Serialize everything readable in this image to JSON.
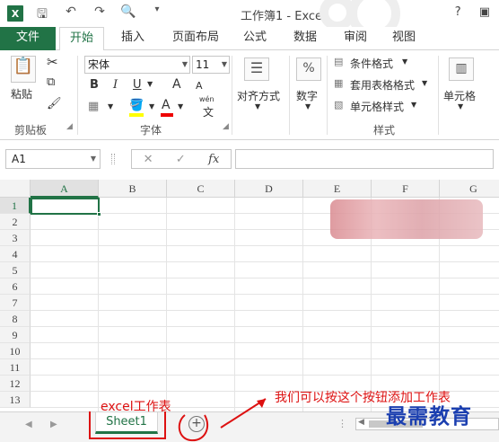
{
  "window": {
    "app_icon": "X",
    "title": "工作簿1 - Excel",
    "help": "?",
    "restore": "▣"
  },
  "ribbon_tabs": [
    "文件",
    "开始",
    "插入",
    "页面布局",
    "公式",
    "数据",
    "审阅",
    "视图"
  ],
  "clipboard": {
    "paste": "粘贴",
    "group": "剪贴板"
  },
  "font": {
    "name": "宋体",
    "size": "11",
    "bold": "B",
    "italic": "I",
    "underline": "U",
    "grow": "A",
    "shrink": "A",
    "font_color": "A",
    "phonetic_top": "wén",
    "phonetic_bottom": "文",
    "group": "字体"
  },
  "alignment": {
    "label": "对齐方式"
  },
  "number": {
    "label": "数字",
    "icon": "%"
  },
  "styles": {
    "conditional": "条件格式",
    "table": "套用表格格式",
    "cell_styles": "单元格样式",
    "group": "样式"
  },
  "cells": {
    "label": "单元格"
  },
  "formula_bar": {
    "name_box": "A1",
    "cancel": "✕",
    "enter": "✓",
    "fx": "fx",
    "value": ""
  },
  "grid": {
    "columns": [
      "A",
      "B",
      "C",
      "D",
      "E",
      "F",
      "G"
    ],
    "rows": [
      "1",
      "2",
      "3",
      "4",
      "5",
      "6",
      "7",
      "8",
      "9",
      "10",
      "11",
      "12",
      "13"
    ],
    "selected_cell": "A1"
  },
  "sheets": {
    "tabs": [
      "Sheet1"
    ],
    "active": "Sheet1",
    "add": "+"
  },
  "annotations": {
    "left": "excel工作表",
    "right": "我们可以按这个按钮添加工作表",
    "watermark": "最需教育"
  },
  "colors": {
    "accent": "#217346",
    "annotation": "#dd1111",
    "watermark": "#1b3fb0"
  }
}
